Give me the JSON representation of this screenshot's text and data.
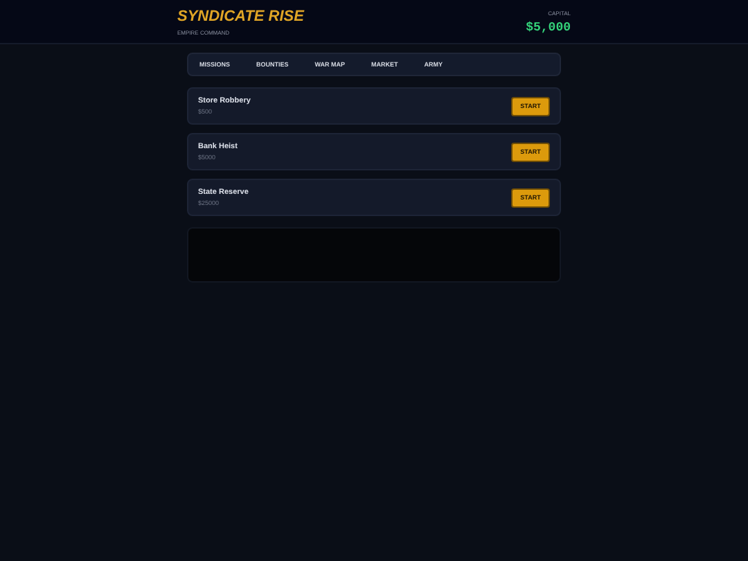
{
  "header": {
    "title": "SYNDICATE RISE",
    "subtitle": "EMPIRE COMMAND",
    "capital_label": "CAPITAL",
    "capital_value": "$5,000"
  },
  "tabs": [
    {
      "label": "MISSIONS",
      "selected": false
    },
    {
      "label": "BOUNTIES",
      "selected": false
    },
    {
      "label": "WAR MAP",
      "selected": false
    },
    {
      "label": "MARKET",
      "selected": false
    },
    {
      "label": "ARMY",
      "selected": false
    }
  ],
  "missions": [
    {
      "name": "Store Robbery",
      "reward": "$500",
      "button": "START"
    },
    {
      "name": "Bank Heist",
      "reward": "$5000",
      "button": "START"
    },
    {
      "name": "State Reserve",
      "reward": "$25000",
      "button": "START"
    }
  ]
}
